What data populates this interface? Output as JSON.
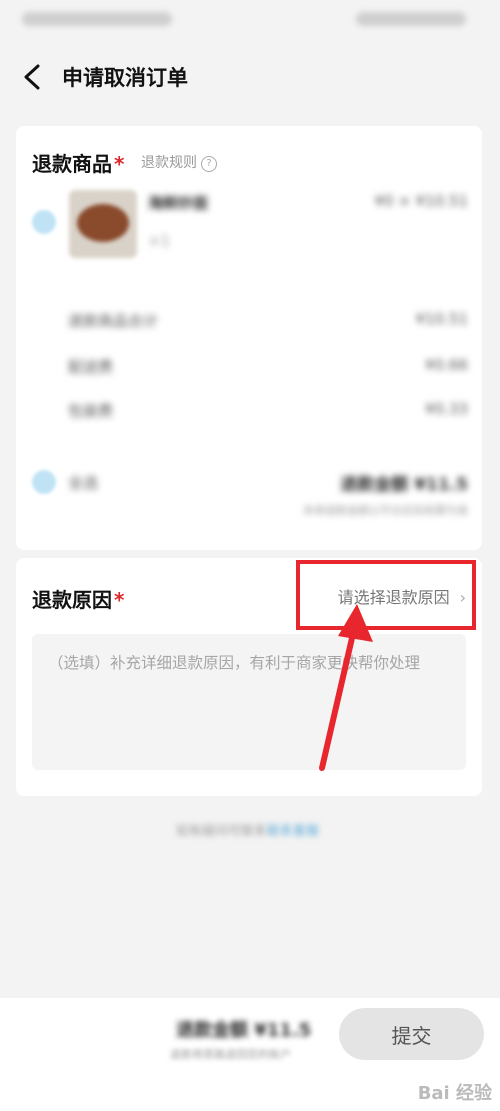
{
  "header": {
    "title": "申请取消订单",
    "back_label": "<"
  },
  "refund_items": {
    "title": "退款商品",
    "rules_label": "退款规则",
    "product": {
      "name": "海鲜炒面",
      "price": "¥0 × ¥10.51",
      "qty": "×1"
    },
    "rows": [
      {
        "label": "退款商品合计",
        "value": "¥10.51"
      },
      {
        "label": "配送费",
        "value": "¥0.66"
      },
      {
        "label": "包装费",
        "value": "¥0.33"
      }
    ],
    "select_all_label": "全选",
    "total": "退款金额 ¥11.5",
    "total_note": "本单退款金额以平台实际核算为准"
  },
  "refund_reason": {
    "title": "退款原因",
    "select_placeholder": "请选择退款原因",
    "textarea_placeholder": "（选填）补充详细退款原因，有利于商家更快帮你处理"
  },
  "footer": {
    "text": "如有疑问可联系",
    "link": "联系客服"
  },
  "bottom_bar": {
    "refund_amount": "退款金额 ¥11.5",
    "refund_note": "退款将原路退回您的账户",
    "submit_label": "提交"
  },
  "watermark": "Bai 经验",
  "colors": {
    "highlight": "#e8262d",
    "star": "#e0262b"
  }
}
